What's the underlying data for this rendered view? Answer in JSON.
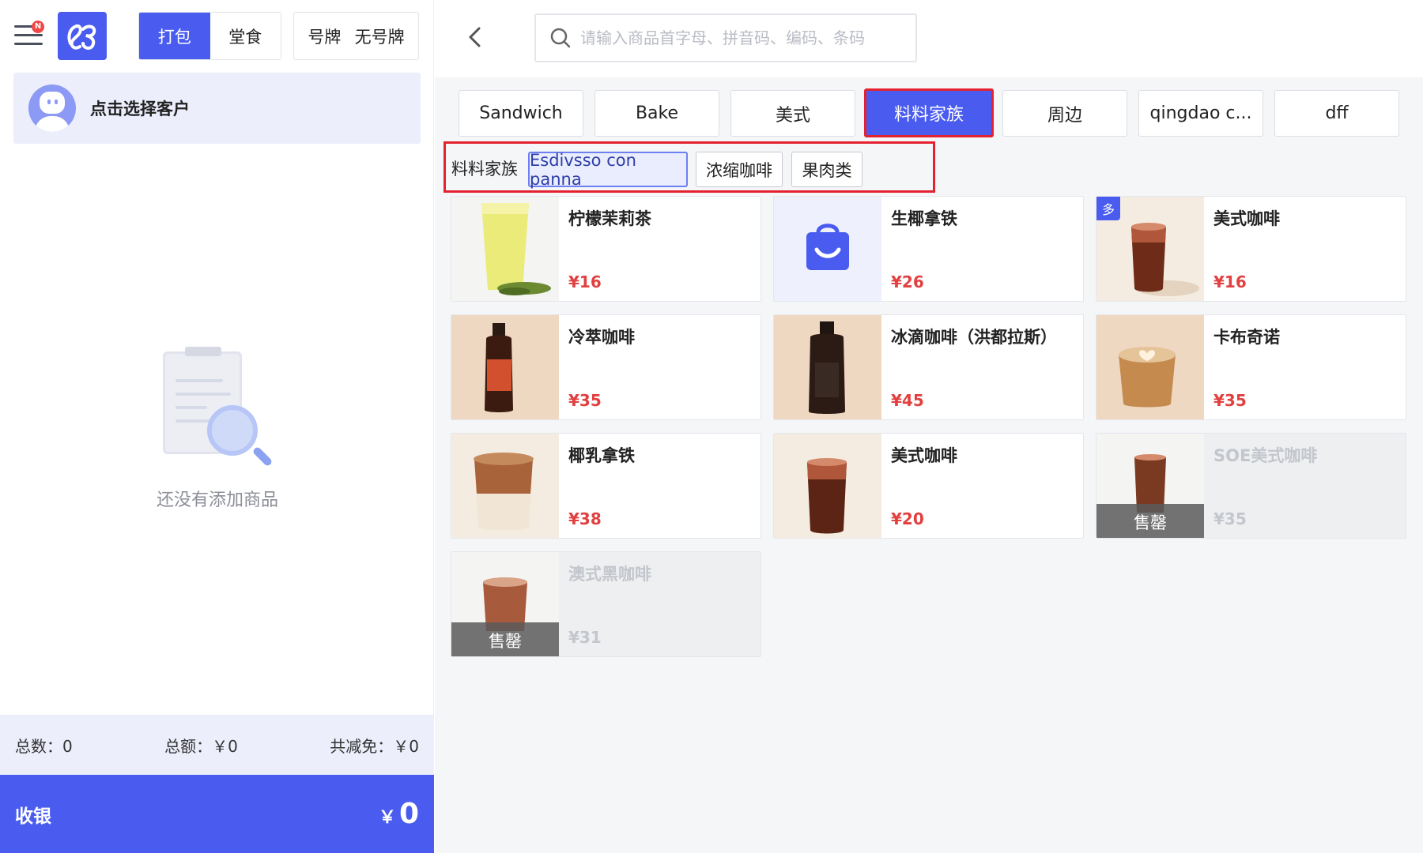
{
  "left": {
    "menu_badge": "N",
    "modes": [
      "打包",
      "堂食"
    ],
    "active_mode": 0,
    "number_options": [
      "号牌",
      "无号牌"
    ],
    "customer_label": "点击选择客户",
    "empty_text": "还没有添加商品",
    "totals": {
      "count": "总数：0",
      "amount": "总额：￥0",
      "discount": "共减免：￥0"
    },
    "checkout": {
      "label": "收银",
      "currency": "￥",
      "amount": "0"
    }
  },
  "header": {
    "search_placeholder": "请输入商品首字母、拼音码、编码、条码"
  },
  "categories": [
    "Sandwich",
    "Bake",
    "美式",
    "料料家族",
    "周边",
    "qingdao c...",
    "dff"
  ],
  "active_category": 3,
  "subcategory": {
    "title": "料料家族",
    "chips": [
      "Esdivsso con panna",
      "浓缩咖啡",
      "果肉类"
    ],
    "active_chip": 0
  },
  "products": [
    {
      "name": "柠檬茉莉茶",
      "price": "¥16",
      "sold_out": false,
      "thumb": "lemon-tea-image"
    },
    {
      "name": "生椰拿铁",
      "price": "¥26",
      "sold_out": false,
      "thumb": "shopping-bag-icon"
    },
    {
      "name": "美式咖啡",
      "price": "¥16",
      "sold_out": false,
      "thumb": "iced-coffee-image",
      "badge": "多"
    },
    {
      "name": "冷萃咖啡",
      "price": "¥35",
      "sold_out": false,
      "thumb": "cold-brew-bottle-image"
    },
    {
      "name": "冰滴咖啡（洪都拉斯）",
      "price": "¥45",
      "sold_out": false,
      "thumb": "drip-bottle-image"
    },
    {
      "name": "卡布奇诺",
      "price": "¥35",
      "sold_out": false,
      "thumb": "cappuccino-image"
    },
    {
      "name": "椰乳拿铁",
      "price": "¥38",
      "sold_out": false,
      "thumb": "coconut-latte-image"
    },
    {
      "name": "美式咖啡",
      "price": "¥20",
      "sold_out": false,
      "thumb": "iced-coffee-image"
    },
    {
      "name": "SOE美式咖啡",
      "price": "¥35",
      "sold_out": true,
      "sold_label": "售罄",
      "thumb": "iced-coffee-image"
    },
    {
      "name": "澳式黑咖啡",
      "price": "¥31",
      "sold_out": true,
      "sold_label": "售罄",
      "thumb": "iced-latte-image"
    }
  ],
  "colors": {
    "primary": "#4a5cf0",
    "price": "#e24040",
    "highlight_box": "#e4222f"
  }
}
